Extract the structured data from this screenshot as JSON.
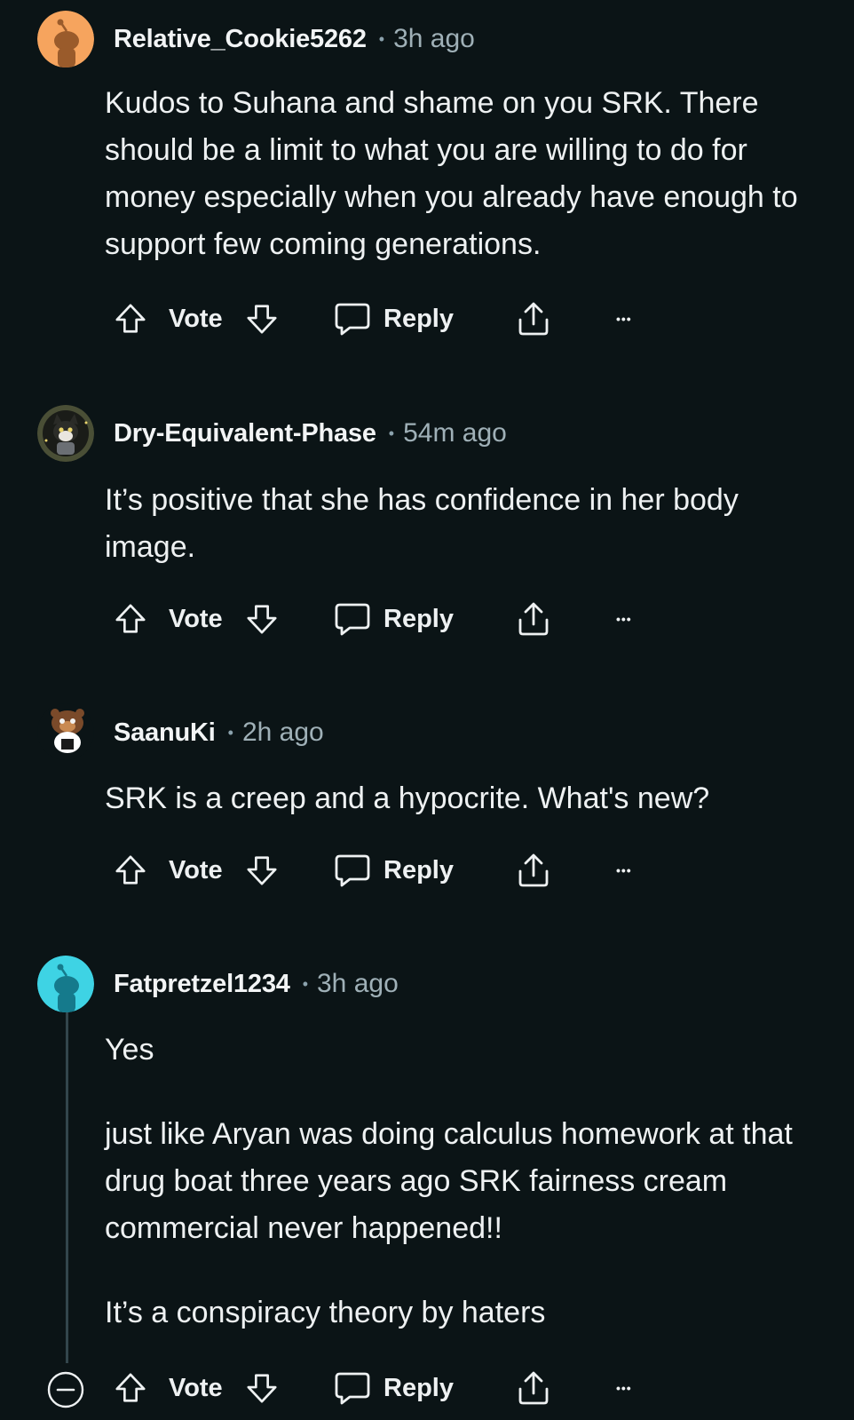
{
  "comments": [
    {
      "username": "Relative_Cookie5262",
      "time": "3h ago",
      "avatar_color": "#f6a45e",
      "avatar_icon": "snoo-avatar-orange",
      "body": [
        "Kudos to Suhana and shame on you SRK. There should be a limit to what you are willing to do for money especially when you already have enough to support few coming generations."
      ]
    },
    {
      "username": "Dry-Equivalent-Phase",
      "time": "54m ago",
      "avatar_color": "#4a4f36",
      "avatar_icon": "cat-avatar",
      "body": [
        "It’s positive that she has confidence in her body image."
      ]
    },
    {
      "username": "SaanuKi",
      "time": "2h ago",
      "avatar_color": "#0b1416",
      "avatar_icon": "bear-snoo-avatar",
      "body": [
        "SRK is a creep and a hypocrite. What's new?"
      ]
    },
    {
      "username": "Fatpretzel1234",
      "time": "3h ago",
      "avatar_color": "#3ed3e4",
      "avatar_icon": "snoo-avatar-cyan",
      "body": [
        "Yes",
        "just like Aryan was doing calculus homework at that drug boat three years ago SRK fairness cream commercial never happened!!",
        "It’s a conspiracy theory by haters"
      ]
    }
  ],
  "actions": {
    "vote_label": "Vote",
    "reply_label": "Reply",
    "upvote_icon": "arrow-up-icon",
    "downvote_icon": "arrow-down-icon",
    "reply_icon": "speech-bubble-icon",
    "share_icon": "share-icon",
    "more_icon": "ellipsis-icon",
    "more_glyph": "•••"
  },
  "colors": {
    "background": "#0b1416",
    "text": "#eef1f2",
    "muted": "#9fb0b7"
  }
}
